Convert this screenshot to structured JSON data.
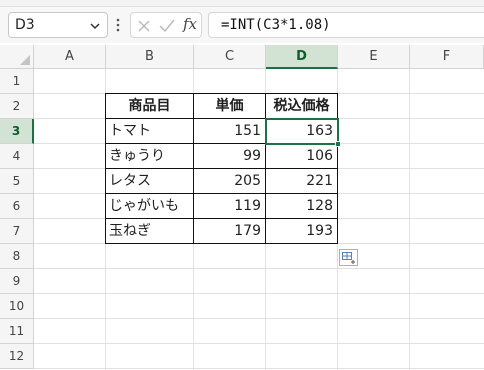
{
  "name_box": {
    "value": "D3"
  },
  "formula_bar": {
    "formula": "=INT(C3*1.08)"
  },
  "columns": [
    "A",
    "B",
    "C",
    "D",
    "E",
    "F"
  ],
  "rows": [
    "1",
    "2",
    "3",
    "4",
    "5",
    "6",
    "7",
    "8",
    "9",
    "10",
    "11",
    "12"
  ],
  "selected_cell": "D3",
  "table": {
    "headers": [
      "商品目",
      "単価",
      "税込価格"
    ],
    "rows": [
      {
        "item": "トマト",
        "price": "151",
        "tax_price": "163"
      },
      {
        "item": "きゅうり",
        "price": "99",
        "tax_price": "106"
      },
      {
        "item": "レタス",
        "price": "205",
        "tax_price": "221"
      },
      {
        "item": "じゃがいも",
        "price": "119",
        "tax_price": "128"
      },
      {
        "item": "玉ねぎ",
        "price": "179",
        "tax_price": "193"
      }
    ]
  },
  "icons": {
    "name_box_dropdown": "chevron-down-icon",
    "more_options": "more-vertical-icon",
    "cancel": "close-icon",
    "enter": "check-icon",
    "insert_function": "fx-icon",
    "quick_analysis": "quick-analysis-icon",
    "select_all": "select-all-icon"
  },
  "colors": {
    "accent": "#1e7145",
    "header_selected_bg": "#d3e3d3"
  }
}
